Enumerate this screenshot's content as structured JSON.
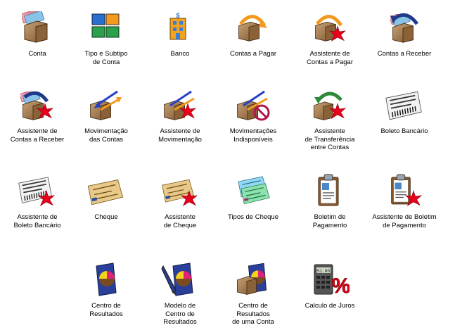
{
  "items": [
    {
      "label": "Conta",
      "icon": "wallet-money-icon"
    },
    {
      "label": "Tipo e Subtipo\nde Conta",
      "icon": "colored-wallets-icon"
    },
    {
      "label": "Banco",
      "icon": "bank-building-icon"
    },
    {
      "label": "Contas a Pagar",
      "icon": "wallet-outgoing-arrow-icon"
    },
    {
      "label": "Assistente de\nContas a Pagar",
      "icon": "wallet-outgoing-wizard-icon"
    },
    {
      "label": "Contas a Receber",
      "icon": "wallet-incoming-arrow-icon"
    },
    {
      "label": "Assistente de\nContas a Receber",
      "icon": "wallet-incoming-wizard-icon"
    },
    {
      "label": "Movimentação\ndas Contas",
      "icon": "wallet-transfer-arrows-icon"
    },
    {
      "label": "Assistente de\nMovimentação",
      "icon": "wallet-transfer-wizard-icon"
    },
    {
      "label": "Movimentações\nIndisponíveis",
      "icon": "wallet-transfer-blocked-icon"
    },
    {
      "label": "Assistente\nde Transferência\nentre Contas",
      "icon": "transfer-wizard-icon"
    },
    {
      "label": "Boleto Bancário",
      "icon": "barcode-slip-icon"
    },
    {
      "label": "Assistente de\nBoleto Bancário",
      "icon": "barcode-slip-wizard-icon"
    },
    {
      "label": "Cheque",
      "icon": "cheque-icon"
    },
    {
      "label": "Assistente\nde Cheque",
      "icon": "cheque-wizard-icon"
    },
    {
      "label": "Tipos de Cheque",
      "icon": "cheque-types-icon"
    },
    {
      "label": "Boletim de\nPagamento",
      "icon": "clipboard-payment-icon"
    },
    {
      "label": "Assistente de Boletim\nde Pagamento",
      "icon": "clipboard-payment-wizard-icon"
    },
    {
      "label": "Centro de\nResultados",
      "icon": "pie-chart-book-icon"
    },
    {
      "label": "Modelo de\nCentro de\nResultados",
      "icon": "pie-chart-pen-icon"
    },
    {
      "label": "Centro de\nResultados\nde uma Conta",
      "icon": "wallet-pie-chart-icon"
    },
    {
      "label": "Calculo de Juros",
      "icon": "calculator-percent-icon"
    }
  ],
  "calculator_display": "251.00",
  "percent_symbol": "%",
  "bank_sign": "$",
  "colors": {
    "wallet": "#a0784e",
    "wizard_star": "#e8001c",
    "arrow_orange": "#f39a1e",
    "arrow_blue": "#2440c8",
    "arrow_green": "#2e8a3a"
  }
}
